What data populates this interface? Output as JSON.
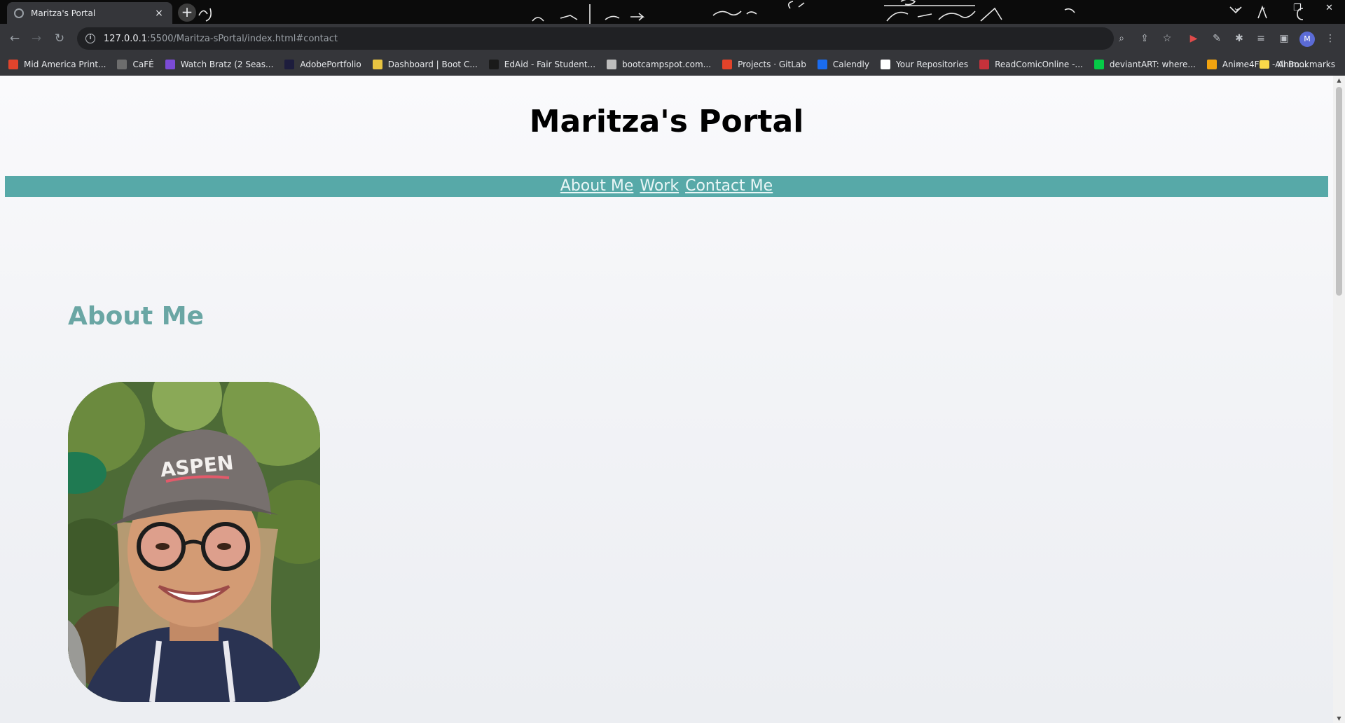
{
  "browser": {
    "tab": {
      "title": "Maritza's Portal",
      "close": "×"
    },
    "new_tab": "+",
    "address": {
      "host": "127.0.0.1",
      "path": ":5500/Maritza-sPortal/index.html#contact"
    },
    "profile_initial": "M",
    "bookmarks": [
      {
        "label": "Mid America Print...",
        "color": "#e0442c"
      },
      {
        "label": "CaFÉ",
        "color": "#6d6d6d"
      },
      {
        "label": "Watch Bratz (2 Seas...",
        "color": "#7b4bd6"
      },
      {
        "label": "AdobePortfolio",
        "color": "#1d1d3d"
      },
      {
        "label": "Dashboard | Boot C...",
        "color": "#e8c441"
      },
      {
        "label": "EdAid - Fair Student...",
        "color": "#1a1a1a"
      },
      {
        "label": "bootcampspot.com...",
        "color": "#bdbdbd"
      },
      {
        "label": "Projects · GitLab",
        "color": "#e2432a"
      },
      {
        "label": "Calendly",
        "color": "#1a6cf0"
      },
      {
        "label": "Your Repositories",
        "color": "#ffffff"
      },
      {
        "label": "ReadComicOnline -...",
        "color": "#c6323b"
      },
      {
        "label": "deviantART: where...",
        "color": "#05cc47"
      },
      {
        "label": "Anime4Fun - Anim...",
        "color": "#f2a30f"
      }
    ],
    "all_bookmarks": "All Bookmarks"
  },
  "page": {
    "title": "Maritza's Portal",
    "nav": [
      "About Me",
      "Work",
      "Contact Me"
    ],
    "about_heading": "About Me"
  },
  "colors": {
    "nav_bar": "#57a9a8",
    "heading_accent": "#6aa6a4"
  }
}
